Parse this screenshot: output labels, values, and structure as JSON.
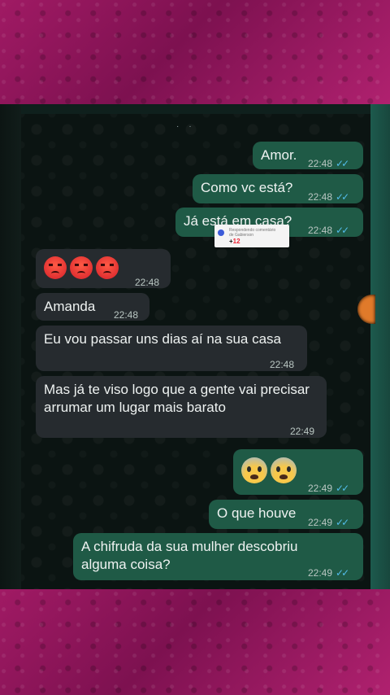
{
  "messages": [
    {
      "id": "m1",
      "side": "out",
      "text": "Amor.",
      "time": "22:48",
      "ticks": "✓✓"
    },
    {
      "id": "m2",
      "side": "out",
      "text": "Como vc está?",
      "time": "22:48",
      "ticks": "✓✓"
    },
    {
      "id": "m3",
      "side": "out",
      "text": "Já está em casa?",
      "time": "22:48",
      "ticks": "✓✓"
    },
    {
      "id": "m4",
      "side": "in",
      "emoji": [
        "angry-face-emoji",
        "angry-face-emoji",
        "angry-face-emoji"
      ],
      "time": "22:48"
    },
    {
      "id": "m5",
      "side": "in",
      "text": "Amanda",
      "time": "22:48"
    },
    {
      "id": "m6",
      "side": "in",
      "text": "Eu vou passar uns dias aí na sua casa",
      "time": "22:48"
    },
    {
      "id": "m7",
      "side": "in",
      "text": "Mas já te viso logo que a gente vai precisar arrumar um lugar mais barato",
      "time": "22:49"
    },
    {
      "id": "m8",
      "side": "out",
      "emoji": [
        "fearful-face-emoji",
        "fearful-face-emoji"
      ],
      "time": "22:49",
      "ticks": "✓✓"
    },
    {
      "id": "m9",
      "side": "out",
      "text": "O que houve",
      "time": "22:49",
      "ticks": "✓✓"
    },
    {
      "id": "m10",
      "side": "out",
      "text": "A chifruda da sua mulher descobriu alguma coisa?",
      "time": "22:49",
      "ticks": "✓✓"
    }
  ],
  "sticker": {
    "line1": "Respondendo comentário de",
    "line2": "Gabierson",
    "plus": "+",
    "num": "12"
  },
  "colors": {
    "outgoing_bubble": "#1f5a46",
    "incoming_bubble": "#262b2f",
    "read_ticks": "#53bdeb",
    "background_band": "#8a1456"
  }
}
